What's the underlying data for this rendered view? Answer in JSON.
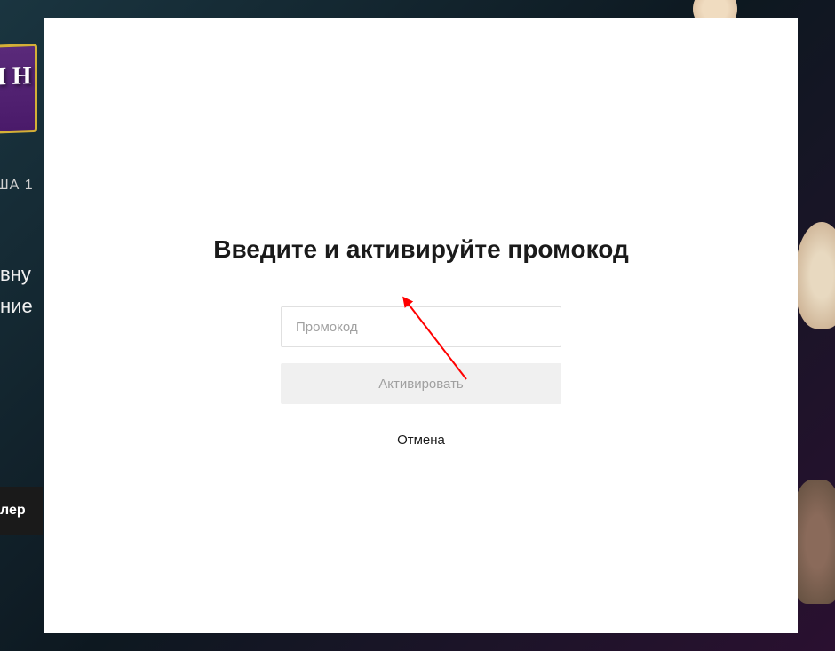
{
  "backdrop": {
    "text1": "ША   1",
    "text2": "вну",
    "text3": "ние",
    "button_label": "лер",
    "logo_text": "И Н"
  },
  "modal": {
    "title": "Введите и активируйте промокод",
    "promo_placeholder": "Промокод",
    "activate_label": "Активировать",
    "cancel_label": "Отмена"
  }
}
